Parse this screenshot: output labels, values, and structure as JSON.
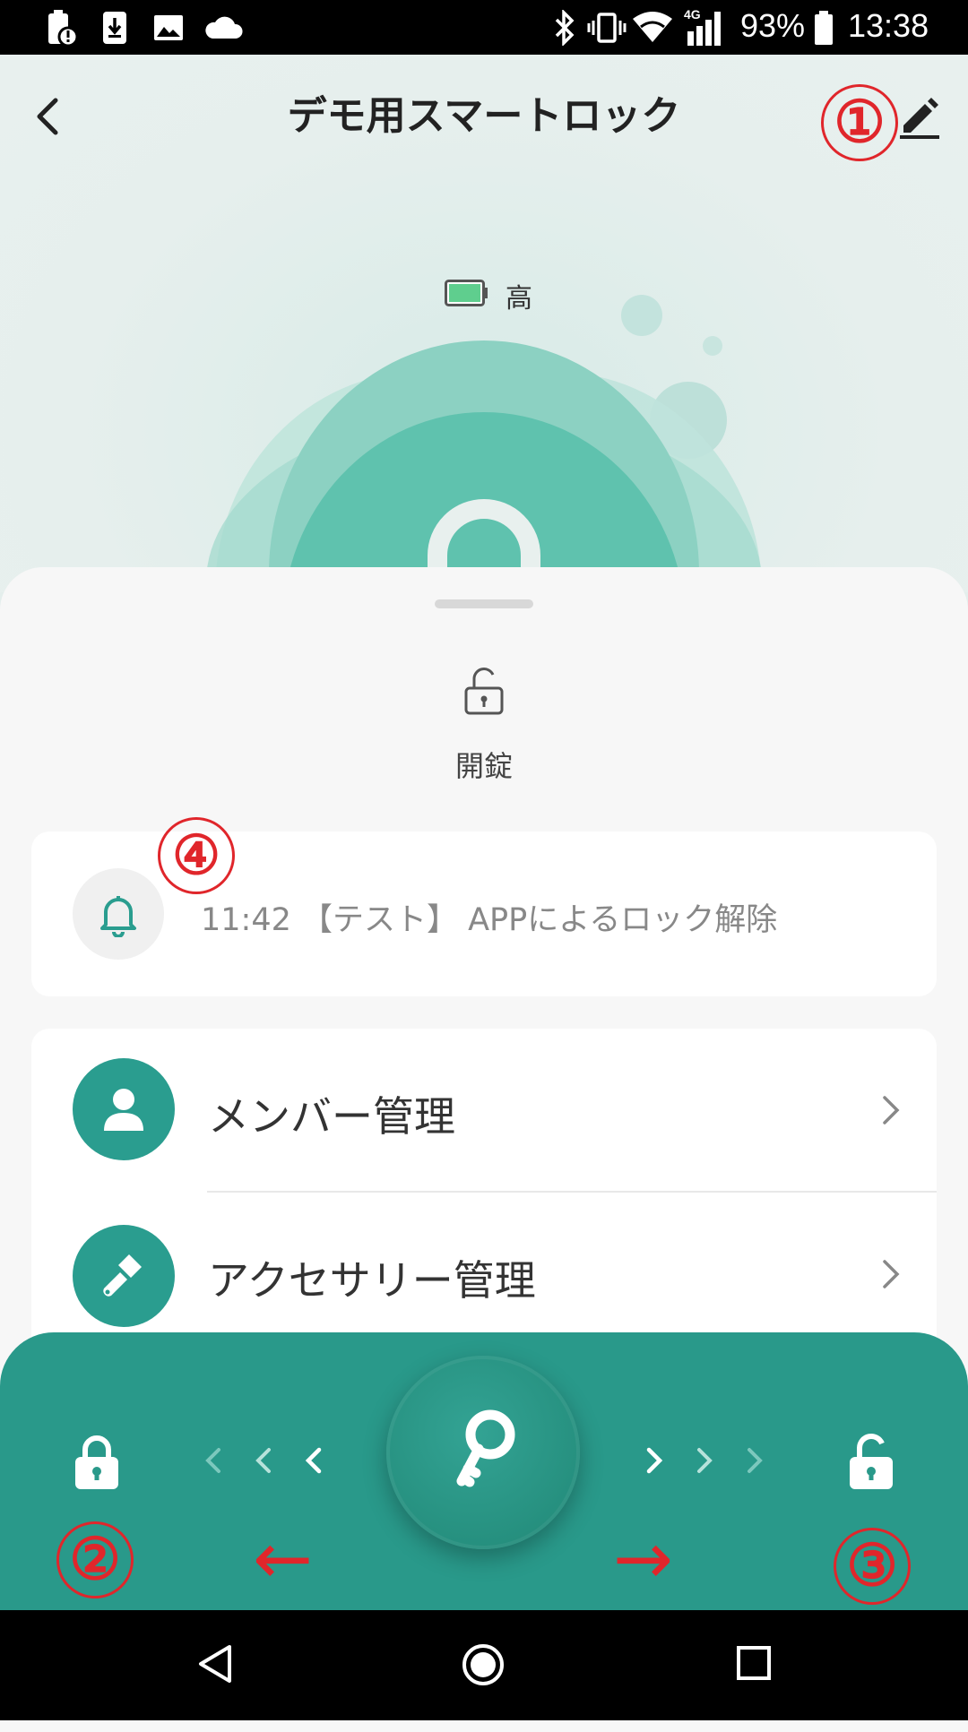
{
  "status_bar": {
    "battery_percent": "93%",
    "time": "13:38",
    "network": "4G",
    "icons": [
      "battery-saver-icon",
      "download-icon",
      "image-icon",
      "cloud-icon",
      "bluetooth-icon",
      "vibrate-icon",
      "wifi-icon",
      "signal-icon",
      "battery-icon"
    ]
  },
  "header": {
    "title": "デモ用スマートロック",
    "back_icon": "chevron-left-icon",
    "edit_icon": "pencil-icon"
  },
  "device": {
    "battery_label": "高",
    "battery_level": 1.0,
    "battery_color": "#5fce8e"
  },
  "lock_state": {
    "label": "開錠",
    "icon": "unlocked-padlock-icon"
  },
  "notification": {
    "icon": "bell-icon",
    "text": "11:42 【テスト】 APPによるロック解除"
  },
  "menu": {
    "items": [
      {
        "label": "メンバー管理",
        "icon": "person-icon"
      },
      {
        "label": "アクセサリー管理",
        "icon": "screwdriver-icon"
      }
    ]
  },
  "controls": {
    "lock_icon": "locked-padlock-icon",
    "unlock_icon": "unlocked-padlock-icon",
    "key_icon": "key-icon"
  },
  "annotations": {
    "marker_1": "①",
    "marker_2": "②",
    "marker_3": "③",
    "marker_4": "④",
    "arrow_left": "←",
    "arrow_right": "→"
  },
  "colors": {
    "accent": "#2a9d8f",
    "annotation_red": "#e0262b"
  }
}
